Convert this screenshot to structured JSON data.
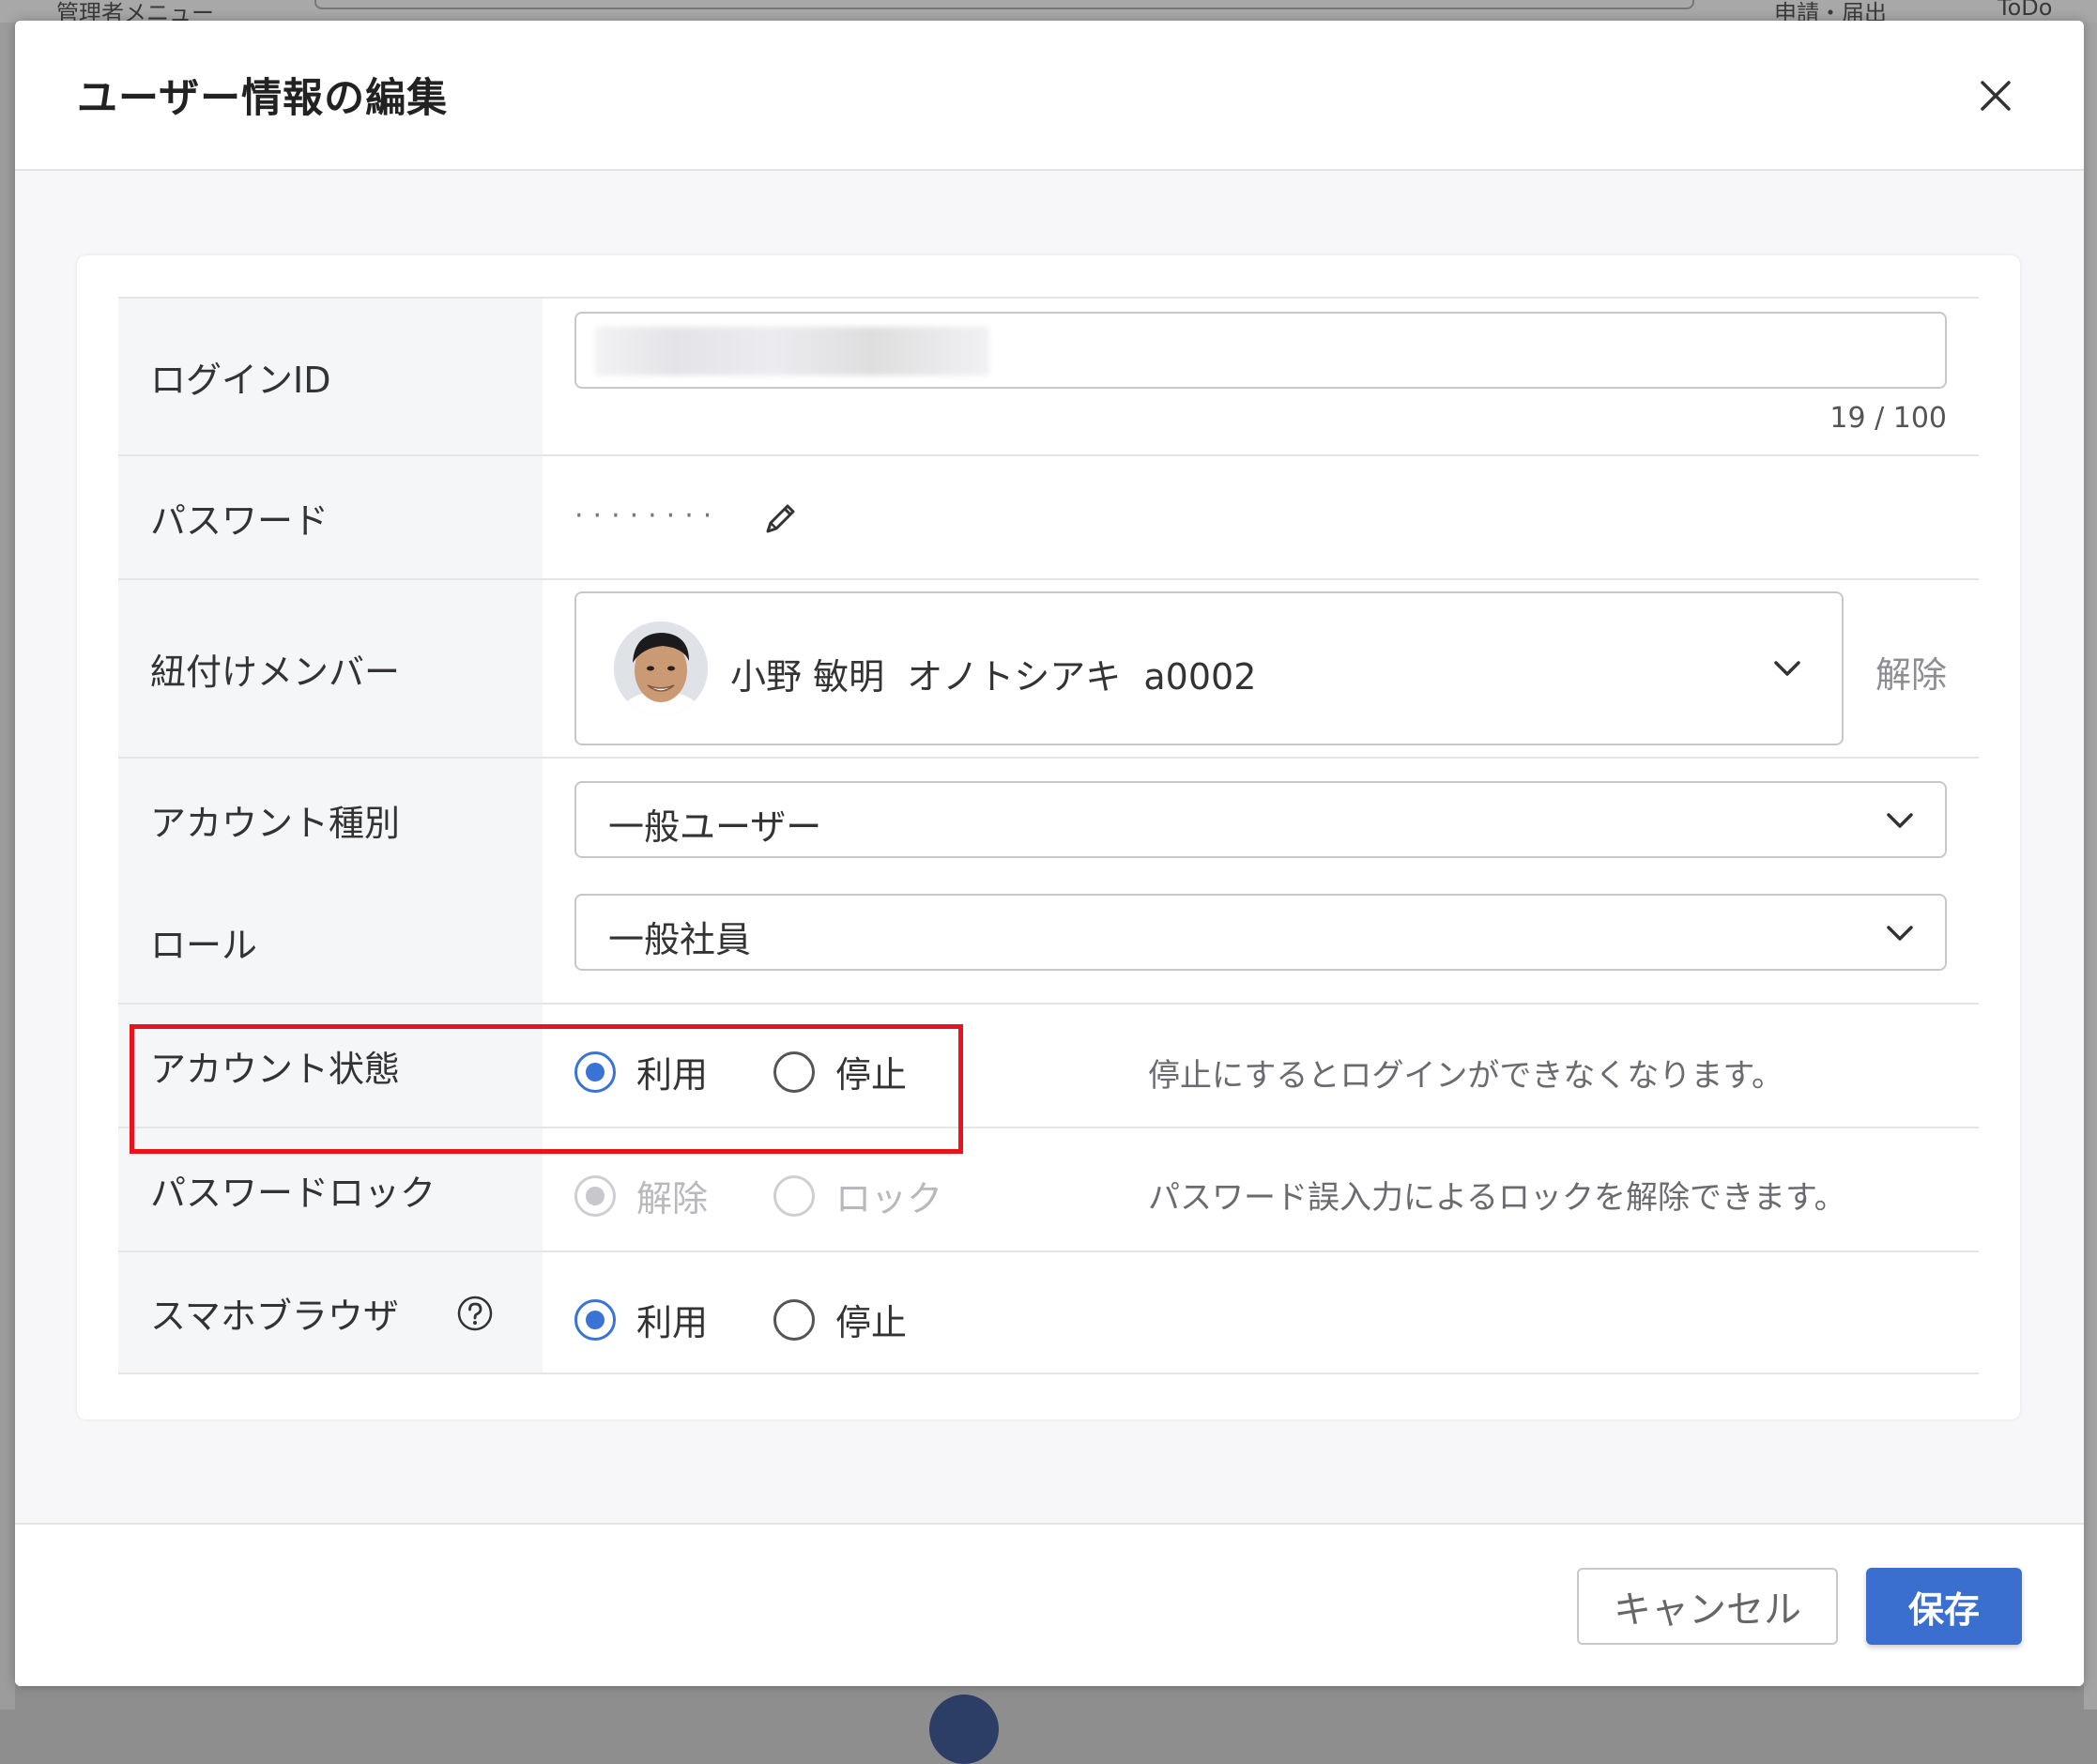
{
  "background": {
    "admin_menu": "管理者メニュー",
    "apply": "申請・届出",
    "todo": "ToDo"
  },
  "modal": {
    "title": "ユーザー情報の編集",
    "close_icon": "close-icon"
  },
  "form": {
    "login_id": {
      "label": "ログインID",
      "value": "",
      "counter": "19 / 100"
    },
    "password": {
      "label": "パスワード",
      "masked": "········",
      "edit_icon": "pencil-icon"
    },
    "linked_member": {
      "label": "紐付けメンバー",
      "value": "小野 敏明  オノトシアキ  a0002",
      "release": "解除"
    },
    "account_type": {
      "label": "アカウント種別",
      "value": "一般ユーザー"
    },
    "role": {
      "label": "ロール",
      "value": "一般社員"
    },
    "account_status": {
      "label": "アカウント状態",
      "options": [
        "利用",
        "停止"
      ],
      "selected": "利用",
      "hint": "停止にするとログインができなくなります。"
    },
    "password_lock": {
      "label": "パスワードロック",
      "options": [
        "解除",
        "ロック"
      ],
      "selected": "解除",
      "hint": "パスワード誤入力によるロックを解除できます。"
    },
    "smartphone_browser": {
      "label": "スマホブラウザ",
      "options": [
        "利用",
        "停止"
      ],
      "selected": "利用"
    }
  },
  "footer": {
    "cancel": "キャンセル",
    "save": "保存"
  },
  "colors": {
    "accent": "#3a73d6",
    "save_button": "#3a6fd0",
    "highlight": "#e8141d"
  }
}
